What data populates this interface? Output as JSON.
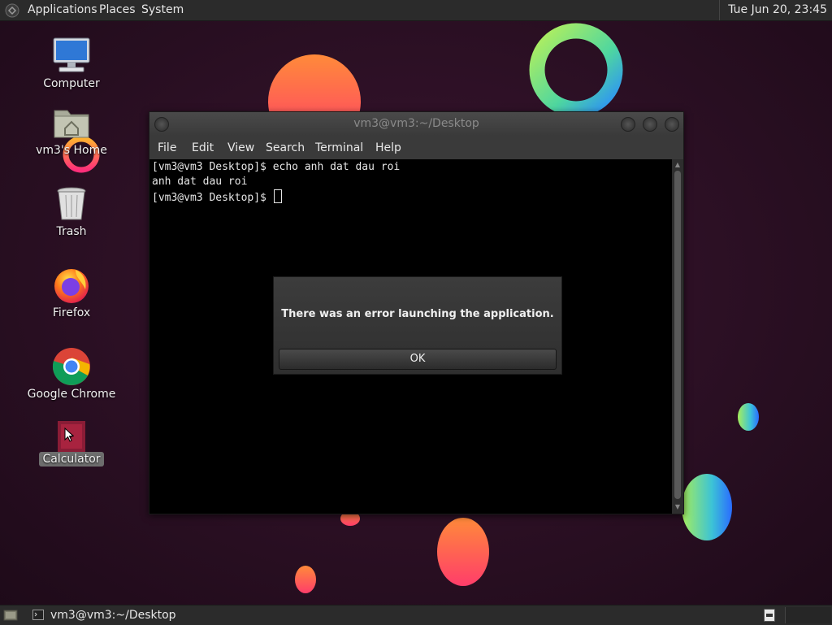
{
  "top_panel": {
    "menus": [
      "Applications",
      "Places",
      "System"
    ],
    "clock": "Tue Jun 20, 23:45"
  },
  "desktop_icons": {
    "computer": "Computer",
    "home": "vm3's Home",
    "trash": "Trash",
    "firefox": "Firefox",
    "chrome": "Google Chrome",
    "calculator": "Calculator"
  },
  "terminal": {
    "title": "vm3@vm3:~/Desktop",
    "menu": [
      "File",
      "Edit",
      "View",
      "Search",
      "Terminal",
      "Help"
    ],
    "lines": [
      "[vm3@vm3 Desktop]$ echo anh dat dau roi",
      "anh dat dau roi",
      "[vm3@vm3 Desktop]$ "
    ]
  },
  "dialog": {
    "message": "There was an error launching the application.",
    "ok_label": "OK"
  },
  "bottom_panel": {
    "task_label": "vm3@vm3:~/Desktop"
  }
}
